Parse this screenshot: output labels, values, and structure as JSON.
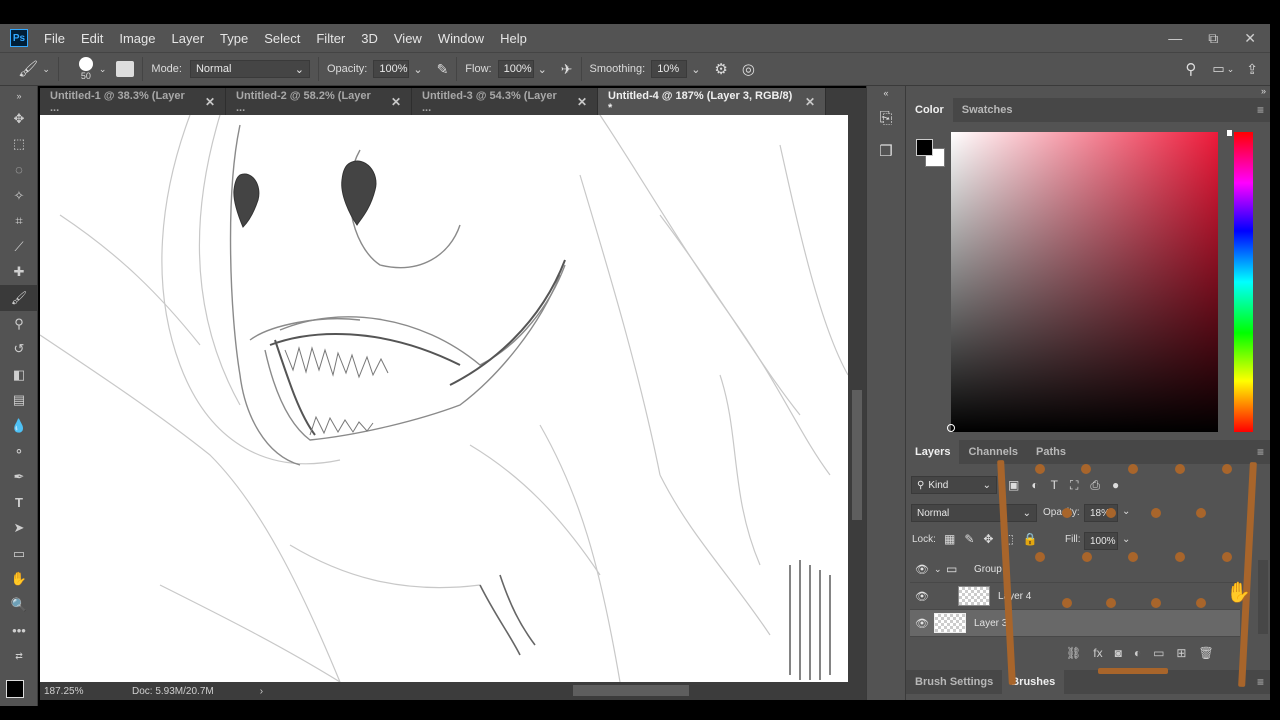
{
  "app": {
    "logo": "Ps"
  },
  "menu": [
    "File",
    "Edit",
    "Image",
    "Layer",
    "Type",
    "Select",
    "Filter",
    "3D",
    "View",
    "Window",
    "Help"
  ],
  "window_controls": {
    "minimize": "—",
    "restore": "⧉",
    "close": "✕"
  },
  "options": {
    "brush_size": "50",
    "mode_label": "Mode:",
    "mode_value": "Normal",
    "opacity_label": "Opacity:",
    "opacity_value": "100%",
    "flow_label": "Flow:",
    "flow_value": "100%",
    "smoothing_label": "Smoothing:",
    "smoothing_value": "10%"
  },
  "tabs": [
    {
      "label": "Untitled-1 @ 38.3% (Layer ...",
      "close": "✕"
    },
    {
      "label": "Untitled-2 @ 58.2% (Layer ...",
      "close": "✕"
    },
    {
      "label": "Untitled-3 @ 54.3% (Layer ...",
      "close": "✕"
    },
    {
      "label": "Untitled-4 @ 187% (Layer 3, RGB/8) *",
      "close": "✕"
    }
  ],
  "status": {
    "zoom": "187.25%",
    "doc": "Doc: 5.93M/20.7M",
    "arrow": "›"
  },
  "color_panel": {
    "tab_color": "Color",
    "tab_swatches": "Swatches",
    "foreground": "#000000",
    "background": "#ffffff"
  },
  "layers_panel": {
    "tab_layers": "Layers",
    "tab_channels": "Channels",
    "tab_paths": "Paths",
    "kind_label": "Kind",
    "blend_mode": "Normal",
    "opacity_label": "Opacity:",
    "opacity_value": "18%",
    "lock_label": "Lock:",
    "fill_label": "Fill:",
    "fill_value": "100%",
    "layers": [
      {
        "name": "Group",
        "type": "group"
      },
      {
        "name": "Layer 4",
        "type": "layer"
      },
      {
        "name": "Layer 3",
        "type": "layer",
        "selected": true
      }
    ]
  },
  "bottom_tabs": {
    "brush_settings": "Brush Settings",
    "brushes": "Brushes"
  },
  "colors": {
    "accent_overlay": "#a8652b",
    "panel_bg": "#535353",
    "dark_bg": "#3c3c3c"
  }
}
